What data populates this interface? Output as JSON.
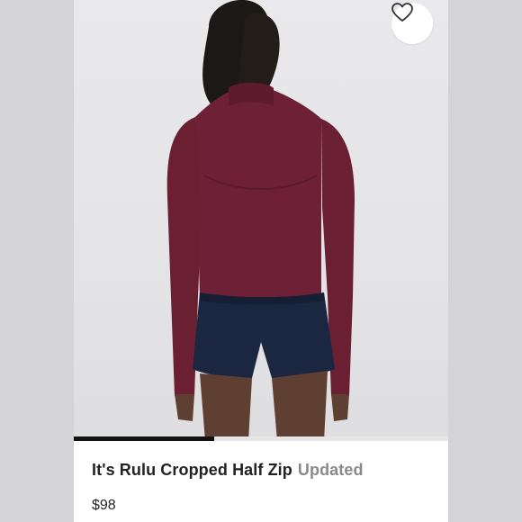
{
  "listing": {
    "title": "It's Rulu Cropped Half Zip",
    "status_badge": "Updated",
    "price": "$98"
  },
  "gallery": {
    "progress_fraction": 0.375
  },
  "icons": {
    "favorite": "heart-outline-icon"
  },
  "colors": {
    "jacket": "#6e2136",
    "shorts": "#1b2640",
    "background": "#e6e6e8",
    "accent_dark": "#111111",
    "badge_gray": "#8a8a8a"
  }
}
